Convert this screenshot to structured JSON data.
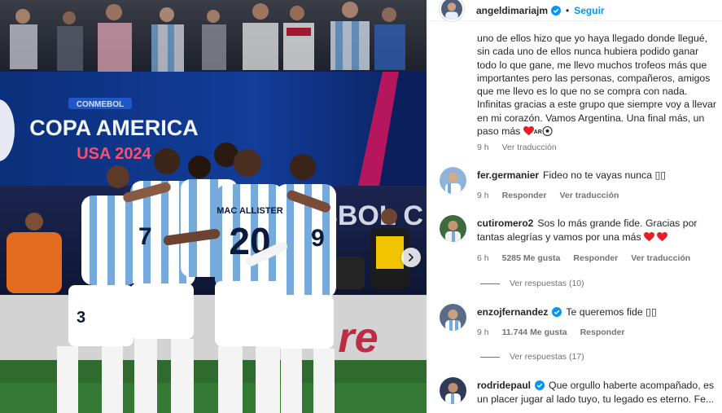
{
  "photo": {
    "banner_top": "CONMEBOL",
    "banner_main": "COPA AMERICA",
    "banner_sub": "USA 2024",
    "wall_text": "SBOL C",
    "jersey_name": "MAC ALLISTER",
    "jersey_number": "20",
    "jersey_number_2": "3",
    "jersey_number_3": "7",
    "jersey_number_4": "9",
    "next_button_icon": "chevron-right-icon",
    "colors": {
      "sky_blue": "#75aadb",
      "white": "#ffffff",
      "navy": "#0b1a3c",
      "pitch": "#2f6b2f"
    }
  },
  "header": {
    "username": "angeldimariajm",
    "separator": "•",
    "follow_label": "Seguir"
  },
  "caption": {
    "text": "uno de ellos hizo que yo haya llegado donde llegué, sin cada uno de ellos nunca hubiera podido ganar todo lo que gane, me llevo muchos trofeos más que importantes pero las personas, compañeros, amigos que me llevo es lo que no se compra con nada. Infinitas gracias a este grupo que siempre voy a llevar en mi corazón. Vamos Argentina. Una final más, un paso más",
    "flag_text": "AR",
    "time": "9 h",
    "translate_label": "Ver traducción"
  },
  "comments": [
    {
      "username": "fer.germanier",
      "text": "Fideo no te vayas nunca ▯▯",
      "time": "9 h",
      "reply_label": "Responder",
      "translate_label": "Ver traducción"
    },
    {
      "username": "cutiromero2",
      "text": "Sos lo más grande fide. Gracias por tantas alegrías y vamos por una más",
      "time": "6 h",
      "likes": "5285 Me gusta",
      "reply_label": "Responder",
      "translate_label": "Ver traducción",
      "view_replies": "Ver respuestas (10)"
    },
    {
      "username": "enzojfernandez",
      "text": "Te queremos fide ▯▯",
      "time": "9 h",
      "likes": "11.744 Me gusta",
      "reply_label": "Responder",
      "view_replies": "Ver respuestas (17)"
    },
    {
      "username": "rodridepaul",
      "text": "Que orgullo haberte acompañado, es un placer jugar al lado tuyo, tu legado es eterno.",
      "more_text": "Fe..."
    }
  ],
  "colors": {
    "accent_blue": "#0095f6",
    "verified_blue": "#0095f6",
    "heart_red": "#ed1c24",
    "muted_text": "#737373",
    "primary_text": "#262626"
  }
}
